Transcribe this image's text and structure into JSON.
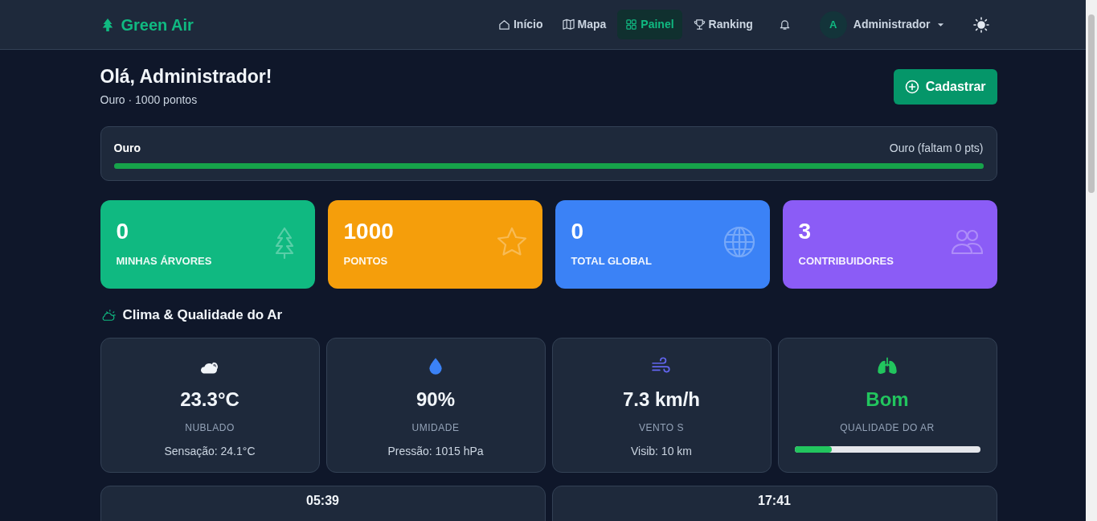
{
  "brand": "Green Air",
  "nav": [
    {
      "label": "Início",
      "selected": false
    },
    {
      "label": "Mapa",
      "selected": false
    },
    {
      "label": "Painel",
      "selected": true
    },
    {
      "label": "Ranking",
      "selected": false
    }
  ],
  "user": {
    "initial": "A",
    "name": "Administrador"
  },
  "greeting": {
    "title": "Olá, Administrador!",
    "subtitle": "Ouro · 1000 pontos"
  },
  "register_button": "Cadastrar",
  "progress": {
    "label": "Ouro",
    "status": "Ouro (faltam 0 pts)",
    "level": 1
  },
  "stats": [
    {
      "value": "0",
      "label": "MINHAS ÁRVORES",
      "color": "#10b981"
    },
    {
      "value": "1000",
      "label": "PONTOS",
      "color": "#f59e0b"
    },
    {
      "value": "0",
      "label": "TOTAL GLOBAL",
      "color": "#3b82f6"
    },
    {
      "value": "3",
      "label": "CONTRIBUIDORES",
      "color": "#8b5cf6"
    }
  ],
  "weather_title": "Clima & Qualidade do Ar",
  "weather": [
    {
      "kind": "text",
      "value": "23.3°C",
      "label": "NUBLADO",
      "detail": "Sensação: 24.1°C"
    },
    {
      "kind": "text",
      "value": "90%",
      "label": "UMIDADE",
      "detail": "Pressão: 1015 hPa"
    },
    {
      "kind": "text",
      "value": "7.3 km/h",
      "label": "VENTO S",
      "detail": "Visib: 10 km"
    },
    {
      "kind": "meter",
      "value": "Bom",
      "label": "QUALIDADE DO AR",
      "level": 0.2
    }
  ],
  "sun_times": [
    "05:39",
    "17:41"
  ]
}
